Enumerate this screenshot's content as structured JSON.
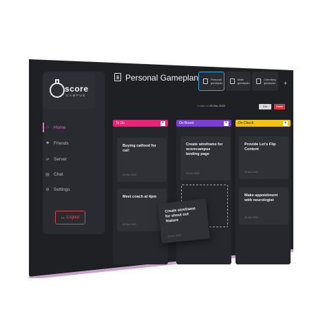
{
  "app": {
    "brand": "score",
    "brand_sub": "CAMPUS"
  },
  "sidebar": {
    "items": [
      {
        "label": "Home",
        "icon": "home-icon"
      },
      {
        "label": "Friends",
        "icon": "friends-icon"
      },
      {
        "label": "Server",
        "icon": "server-icon"
      },
      {
        "label": "Chat",
        "icon": "chat-icon"
      },
      {
        "label": "Settings",
        "icon": "settings-icon"
      }
    ],
    "logout_label": "Logout"
  },
  "header": {
    "title": "Personal Gameplan",
    "tabs": [
      {
        "label": "Personal\ngameplan"
      },
      {
        "label": "Math\ngameplan"
      },
      {
        "label": "Chemistry\ngameplan"
      }
    ],
    "add_tab": "+"
  },
  "meta": {
    "created_label": "Created on",
    "created_date": "25 Dec 2022",
    "edit_label": "Edit",
    "delete_label": "Delete"
  },
  "columns": [
    {
      "title": "To Do",
      "color": "#e8237a",
      "cards": [
        {
          "title": "Buying catfood for cat!",
          "date": "25 Dec 2022"
        },
        {
          "title": "Meet coach at 4pm",
          "date": "25 Dec 2022"
        }
      ]
    },
    {
      "title": "On Board",
      "color": "#7b3fd6",
      "cards": [
        {
          "title": "Create wireframe for scorecampus landing page",
          "date": "25 Dec 2022"
        }
      ]
    },
    {
      "title": "On Check",
      "color": "#f1c214",
      "cards": [
        {
          "title": "Provide Let's Flip Content",
          "date": "25 Dec 2022"
        },
        {
          "title": "Make appointment with neurologist",
          "date": "25 Dec 2022"
        }
      ]
    }
  ],
  "dragging_card": {
    "title": "Create wireframe for shout out feature",
    "date": "25 Dec 2022"
  },
  "colors": {
    "accent": "#e46bd0",
    "danger": "#d23b40",
    "tab_border": "#3fa3d8"
  }
}
